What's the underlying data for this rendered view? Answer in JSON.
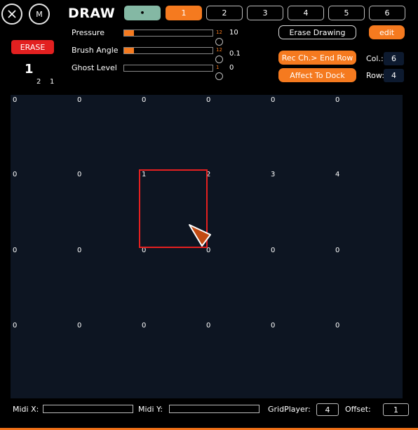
{
  "header": {
    "close_label": "",
    "m_label": "M",
    "title": "DRAW",
    "tabs": [
      {
        "label": "•",
        "state": "dot"
      },
      {
        "label": "1",
        "state": "active"
      },
      {
        "label": "2",
        "state": "normal"
      },
      {
        "label": "3",
        "state": "normal"
      },
      {
        "label": "4",
        "state": "normal"
      },
      {
        "label": "5",
        "state": "normal"
      },
      {
        "label": "6",
        "state": "normal"
      }
    ]
  },
  "left_panel": {
    "erase_label": "ERASE",
    "big_number": "1",
    "sub_a": "2",
    "sub_b": "1"
  },
  "params": [
    {
      "label": "Pressure",
      "max": "12",
      "value": "10",
      "fill_fraction": 0.11
    },
    {
      "label": "Brush Angle",
      "max": "12",
      "value": "0.1",
      "fill_fraction": 0.11
    },
    {
      "label": "Ghost Level",
      "max": "1",
      "value": "0",
      "fill_fraction": 0.0
    }
  ],
  "actions": {
    "erase_drawing": "Erase Drawing",
    "edit": "edit",
    "rec_ch": "Rec Ch.> End Row",
    "affect_dock": "Affect To Dock",
    "col_label": "Col.:",
    "col_value": "6",
    "row_label": "Row:",
    "row_value": "4"
  },
  "grid": {
    "rows": [
      [
        "0",
        "0",
        "0",
        "0",
        "0",
        "0"
      ],
      [
        "0",
        "0",
        "1",
        "2",
        "3",
        "4"
      ],
      [
        "0",
        "0",
        "0",
        "0",
        "0",
        "0"
      ],
      [
        "0",
        "0",
        "0",
        "0",
        "0",
        "0"
      ]
    ]
  },
  "footer": {
    "midi_x_label": "Midi X:",
    "midi_x_value": "",
    "midi_y_label": "Midi Y:",
    "midi_y_value": "",
    "gridplayer_label": "GridPlayer:",
    "gridplayer_value": "4",
    "offset_label": "Offset:",
    "offset_value": "1"
  },
  "colors": {
    "accent": "#f57a1f",
    "erase": "#e32020",
    "selection": "#e62020",
    "grid_bg": "#0d1522",
    "dot_tab": "#84b8a4"
  }
}
